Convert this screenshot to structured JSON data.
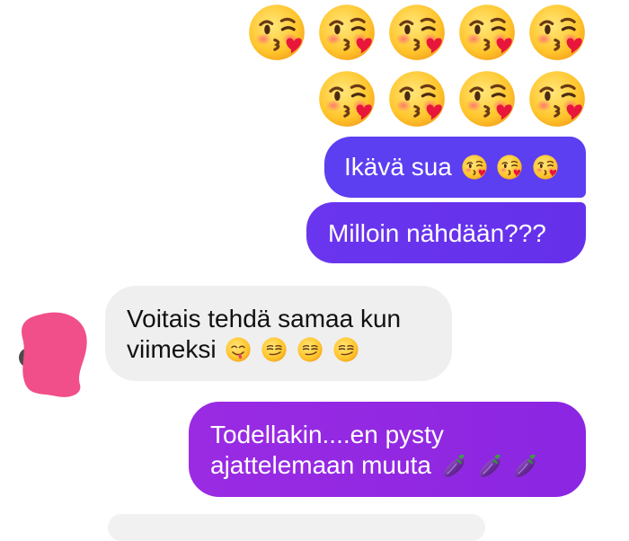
{
  "emoji_grid": {
    "row1": [
      "kissing-heart",
      "kissing-heart",
      "kissing-heart",
      "kissing-heart",
      "kissing-heart"
    ],
    "row2": [
      "kissing-heart",
      "kissing-heart",
      "kissing-heart",
      "kissing-heart"
    ]
  },
  "messages": [
    {
      "side": "right",
      "text": "Ikävä sua",
      "emojis": [
        "kissing-heart",
        "kissing-heart",
        "kissing-heart"
      ]
    },
    {
      "side": "right",
      "text": "Milloin nähdään???"
    },
    {
      "side": "left",
      "line1": "Voitais tehdä samaa kun",
      "line2": "viimeksi",
      "emojis": [
        "yum",
        "smirk",
        "smirk",
        "smirk"
      ]
    },
    {
      "side": "right",
      "line1": "Todellakin....en pysty",
      "line2": "ajattelemaan muuta",
      "emojis": [
        "eggplant",
        "eggplant",
        "eggplant"
      ]
    }
  ],
  "colors": {
    "outgoing_blue": "#5b3ff0",
    "outgoing_violet": "#6a35ee",
    "outgoing_purple": "#9a2be3",
    "incoming_gray": "#efefef",
    "avatar_redaction": "#f04f89"
  }
}
